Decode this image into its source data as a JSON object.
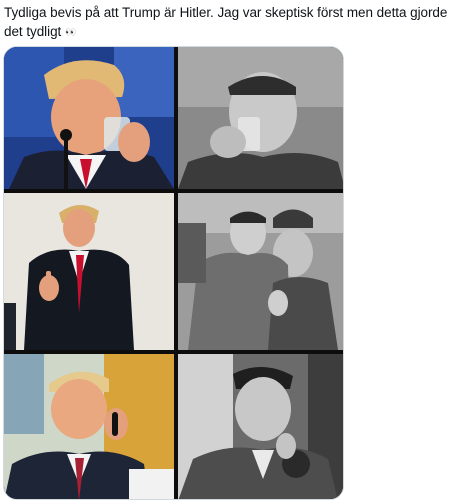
{
  "tweet": {
    "text": "Tydliga bevis på att Trump är Hitler. Jag var skeptisk först men detta gjorde det tydligt",
    "emoji": "👀"
  },
  "media": {
    "layout": "3 rows × 2 columns photo comparison grid",
    "left_column": "color photos",
    "right_column": "black-and-white photos",
    "panels": [
      {
        "row": 1,
        "col": 1,
        "scene": "man-in-suit-drinking-water",
        "tone": "color"
      },
      {
        "row": 1,
        "col": 2,
        "scene": "man-drinking-water",
        "tone": "bw"
      },
      {
        "row": 2,
        "col": 1,
        "scene": "man-in-suit-thumbs-up",
        "tone": "color"
      },
      {
        "row": 2,
        "col": 2,
        "scene": "man-in-coat-thumbs-up-crowd",
        "tone": "bw"
      },
      {
        "row": 3,
        "col": 1,
        "scene": "man-smiling-on-phone-at-desk",
        "tone": "color"
      },
      {
        "row": 3,
        "col": 2,
        "scene": "man-smiling-on-phone",
        "tone": "bw"
      }
    ]
  },
  "colors": {
    "text": "#0f1419",
    "frame_border": "#cfd9de",
    "gutter": "#0d0d0d"
  }
}
